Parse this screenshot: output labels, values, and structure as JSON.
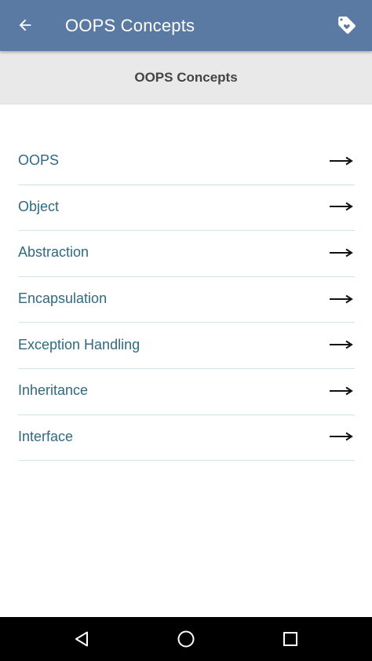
{
  "toolbar": {
    "title": "OOPS Concepts",
    "back_icon": "arrow-left-icon",
    "tag_icon": "tag-icon",
    "background": "#5a7aa3"
  },
  "header": {
    "title": "OOPS Concepts"
  },
  "topics": [
    {
      "label": "OOPS"
    },
    {
      "label": "Object"
    },
    {
      "label": "Abstraction"
    },
    {
      "label": "Encapsulation"
    },
    {
      "label": "Exception Handling"
    },
    {
      "label": "Inheritance"
    },
    {
      "label": "Interface"
    }
  ],
  "navbar": {
    "back_icon": "triangle-back-icon",
    "home_icon": "circle-home-icon",
    "recent_icon": "square-recents-icon"
  },
  "colors": {
    "item_text": "#2f6a80",
    "divider": "#cfe3ea",
    "header_band": "#e9e9e9"
  }
}
